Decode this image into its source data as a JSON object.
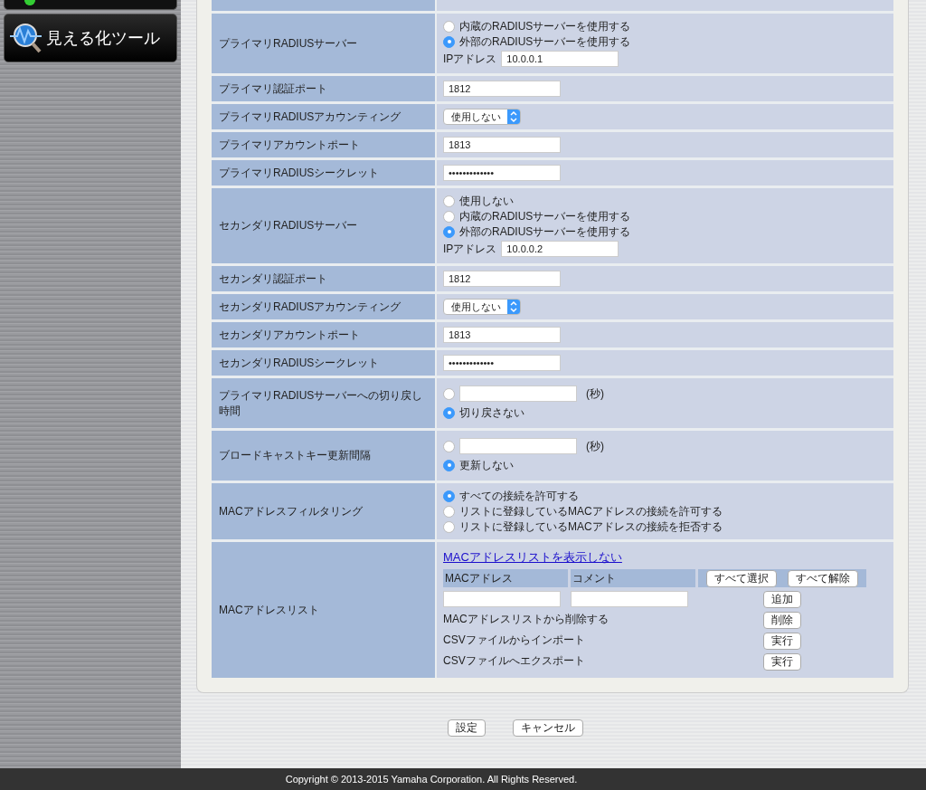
{
  "sidebar": {
    "items": [
      {
        "label": "見える化ツール"
      }
    ]
  },
  "settings": {
    "rows": [
      {
        "label": "プライマリRADIUSサーバー",
        "kind": "radios",
        "options": [
          {
            "label": "内蔵のRADIUSサーバーを使用する",
            "selected": false
          },
          {
            "label": "外部のRADIUSサーバーを使用する",
            "selected": true
          }
        ],
        "ip": {
          "label": "IPアドレス",
          "value": "10.0.0.1"
        }
      },
      {
        "label": "プライマリ認証ポート",
        "kind": "input",
        "value": "1812"
      },
      {
        "label": "プライマリRADIUSアカウンティング",
        "kind": "select",
        "value": "使用しない"
      },
      {
        "label": "プライマリアカウントポート",
        "kind": "input",
        "value": "1813"
      },
      {
        "label": "プライマリRADIUSシークレット",
        "kind": "input",
        "value": "•••••••••••••"
      },
      {
        "label": "セカンダリRADIUSサーバー",
        "kind": "radios",
        "options": [
          {
            "label": "使用しない",
            "selected": false
          },
          {
            "label": "内蔵のRADIUSサーバーを使用する",
            "selected": false
          },
          {
            "label": "外部のRADIUSサーバーを使用する",
            "selected": true
          }
        ],
        "ip": {
          "label": "IPアドレス",
          "value": "10.0.0.2"
        }
      },
      {
        "label": "セカンダリ認証ポート",
        "kind": "input",
        "value": "1812"
      },
      {
        "label": "セカンダリRADIUSアカウンティング",
        "kind": "select",
        "value": "使用しない"
      },
      {
        "label": "セカンダリアカウントポート",
        "kind": "input",
        "value": "1813"
      },
      {
        "label": "セカンダリRADIUSシークレット",
        "kind": "input",
        "value": "•••••••••••••"
      },
      {
        "label": "プライマリRADIUSサーバーへの切り戻し時間",
        "kind": "seconds",
        "options": [
          {
            "unit": "(秒)",
            "selected": false
          },
          {
            "label": "切り戻さない",
            "selected": true
          }
        ]
      },
      {
        "label": "ブロードキャストキー更新間隔",
        "kind": "seconds",
        "options": [
          {
            "unit": "(秒)",
            "selected": false
          },
          {
            "label": "更新しない",
            "selected": true
          }
        ]
      },
      {
        "label": "MACアドレスフィルタリング",
        "kind": "radios",
        "options": [
          {
            "label": "すべての接続を許可する",
            "selected": true
          },
          {
            "label": "リストに登録しているMACアドレスの接続を許可する",
            "selected": false
          },
          {
            "label": "リストに登録しているMACアドレスの接続を拒否する",
            "selected": false
          }
        ]
      },
      {
        "label": "MACアドレスリスト",
        "kind": "maclist",
        "link": "MACアドレスリストを表示しない",
        "columns": [
          "MACアドレス",
          "コメント"
        ],
        "header_buttons": [
          "すべて選択",
          "すべて解除"
        ],
        "add_button": "追加",
        "actions": [
          {
            "label": "MACアドレスリストから削除する",
            "button": "削除"
          },
          {
            "label": "CSVファイルからインポート",
            "button": "実行"
          },
          {
            "label": "CSVファイルへエクスポート",
            "button": "実行"
          }
        ]
      }
    ]
  },
  "buttons": [
    "設定",
    "キャンセル"
  ],
  "footer": {
    "copyright": "Copyright © 2013-2015 Yamaha Corporation. All Rights Reserved."
  }
}
